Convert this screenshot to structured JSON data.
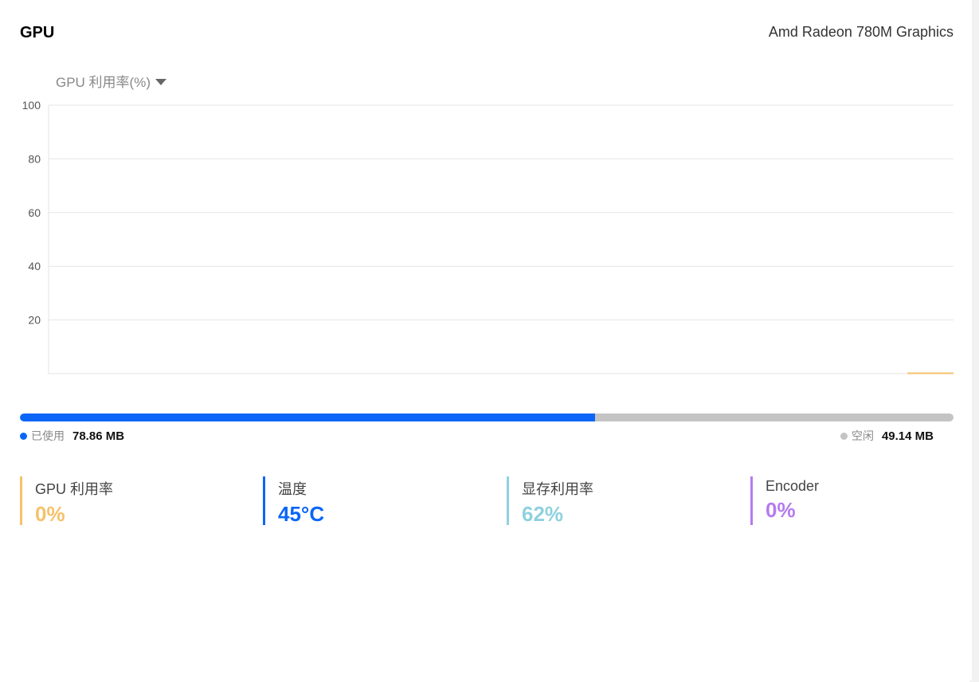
{
  "header": {
    "title": "GPU",
    "device_name": "Amd Radeon 780M Graphics"
  },
  "metric_selector": {
    "selected": "GPU 利用率(%)",
    "icon": "caret-down-icon"
  },
  "chart_data": {
    "type": "line",
    "y_ticks": [
      "100",
      "80",
      "60",
      "40",
      "20"
    ],
    "ylim": [
      0,
      100
    ],
    "grid": true,
    "series": [
      {
        "color": "#f5c26b",
        "values": [
          0,
          0
        ]
      }
    ]
  },
  "memory": {
    "used_fraction": 0.616,
    "used_label": "已使用",
    "used_value": "78.86 MB",
    "free_label": "空闲",
    "free_value": "49.14 MB",
    "used_color": "#0b66f7",
    "free_color": "#c4c4c4"
  },
  "stats": [
    {
      "label": "GPU 利用率",
      "value": "0%",
      "color": "#f5c26b"
    },
    {
      "label": "温度",
      "value": "45°C",
      "color": "#0b66f7"
    },
    {
      "label": "显存利用率",
      "value": "62%",
      "color": "#8fd1e0"
    },
    {
      "label": "Encoder",
      "value": "0%",
      "color": "#b57bee"
    }
  ]
}
